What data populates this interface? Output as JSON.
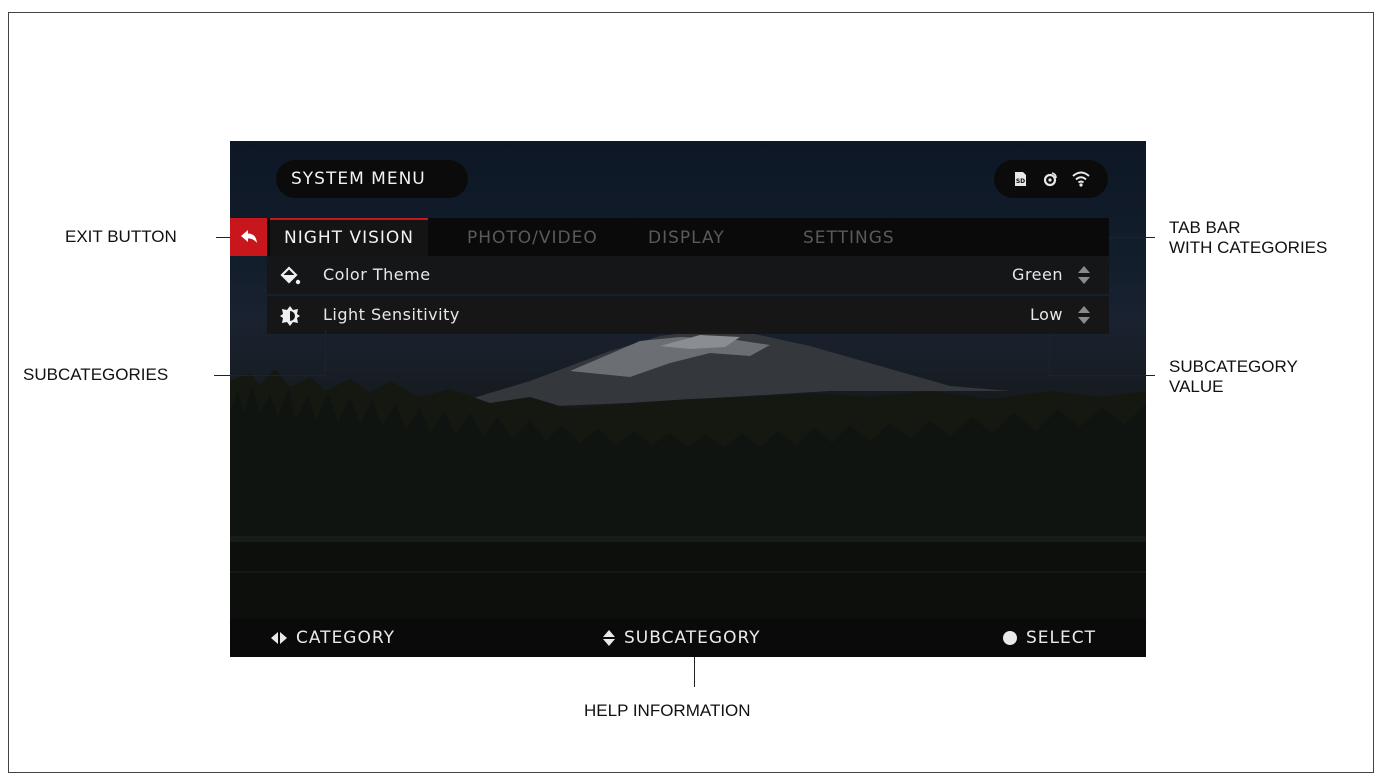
{
  "screen": {
    "title": "SYSTEM MENU",
    "status_icons": [
      "sd-card-icon",
      "satellite-icon",
      "wifi-icon"
    ],
    "exit_icon": "back-arrow-icon",
    "tabs": [
      {
        "label": "NIGHT VISION",
        "active": true
      },
      {
        "label": "PHOTO/VIDEO",
        "active": false
      },
      {
        "label": "DISPLAY",
        "active": false
      },
      {
        "label": "SETTINGS",
        "active": false
      }
    ],
    "rows": [
      {
        "icon": "paint-bucket-icon",
        "label": "Color Theme",
        "value": "Green"
      },
      {
        "icon": "brightness-icon",
        "label": "Light Sensitivity",
        "value": "Low"
      }
    ],
    "help": {
      "category": "CATEGORY",
      "subcategory": "SUBCATEGORY",
      "select": "SELECT"
    }
  },
  "annotations": {
    "exit_button": "EXIT BUTTON",
    "tab_bar_line1": "TAB BAR",
    "tab_bar_line2": "WITH CATEGORIES",
    "subcategories": "SUBCATEGORIES",
    "subcategory_value_line1": "SUBCATEGORY",
    "subcategory_value_line2": "VALUE",
    "help_information": "HELP INFORMATION"
  },
  "colors": {
    "accent": "#c8161d",
    "bar": "#0a0a0a",
    "text": "#f2f2f2",
    "inactive_tab": "#5a5a5a"
  }
}
